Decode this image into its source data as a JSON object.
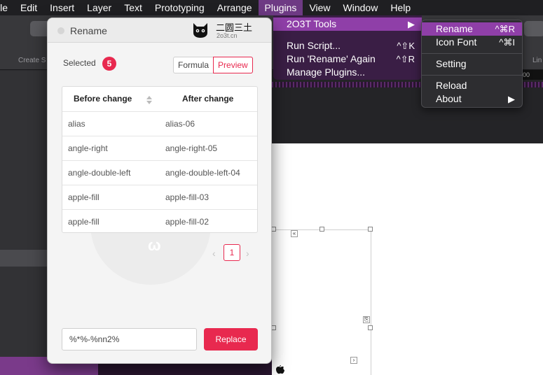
{
  "menubar": {
    "items": [
      "ile",
      "Edit",
      "Insert",
      "Layer",
      "Text",
      "Prototyping",
      "Arrange",
      "Plugins",
      "View",
      "Window",
      "Help"
    ],
    "active": "Plugins"
  },
  "toolbar": {
    "left_label": "Create S",
    "right_label": "Lin"
  },
  "ruler": {
    "value": "00"
  },
  "plugins_menu": {
    "items": [
      {
        "label": "2O3T Tools",
        "shortcut": "▶"
      },
      {
        "label": "Run Script...",
        "shortcut": "^⇧K"
      },
      {
        "label": "Run 'Rename' Again",
        "shortcut": "^⇧R"
      },
      {
        "label": "Manage Plugins...",
        "shortcut": ""
      }
    ]
  },
  "submenu": {
    "items": [
      {
        "label": "Rename",
        "shortcut": "^⌘R"
      },
      {
        "label": "Icon Font",
        "shortcut": "^⌘I"
      },
      {
        "label": "Setting",
        "shortcut": ""
      },
      {
        "label": "Reload",
        "shortcut": ""
      },
      {
        "label": "About",
        "shortcut": "▶"
      }
    ]
  },
  "dialog": {
    "title": "Rename",
    "brand_cn": "二圆三土",
    "brand_url": "2o3t.cn",
    "selected_label": "Selected",
    "selected_count": "5",
    "modes": [
      "Formula",
      "Preview"
    ],
    "active_mode": "Preview",
    "table": {
      "headers": [
        "Before change",
        "After change"
      ],
      "rows": [
        [
          "alias",
          "alias-06"
        ],
        [
          "angle-right",
          "angle-right-05"
        ],
        [
          "angle-double-left",
          "angle-double-left-04"
        ],
        [
          "apple-fill",
          "apple-fill-03"
        ],
        [
          "apple-fill",
          "apple-fill-02"
        ]
      ]
    },
    "pager": {
      "prev": "‹",
      "page": "1",
      "next": "›"
    },
    "pattern_value": "%*%-%nn2%",
    "replace_label": "Replace"
  },
  "colors": {
    "accent": "#e8294f",
    "menu_highlight": "#8f3fa8",
    "menubar_active": "#6e3a84"
  }
}
